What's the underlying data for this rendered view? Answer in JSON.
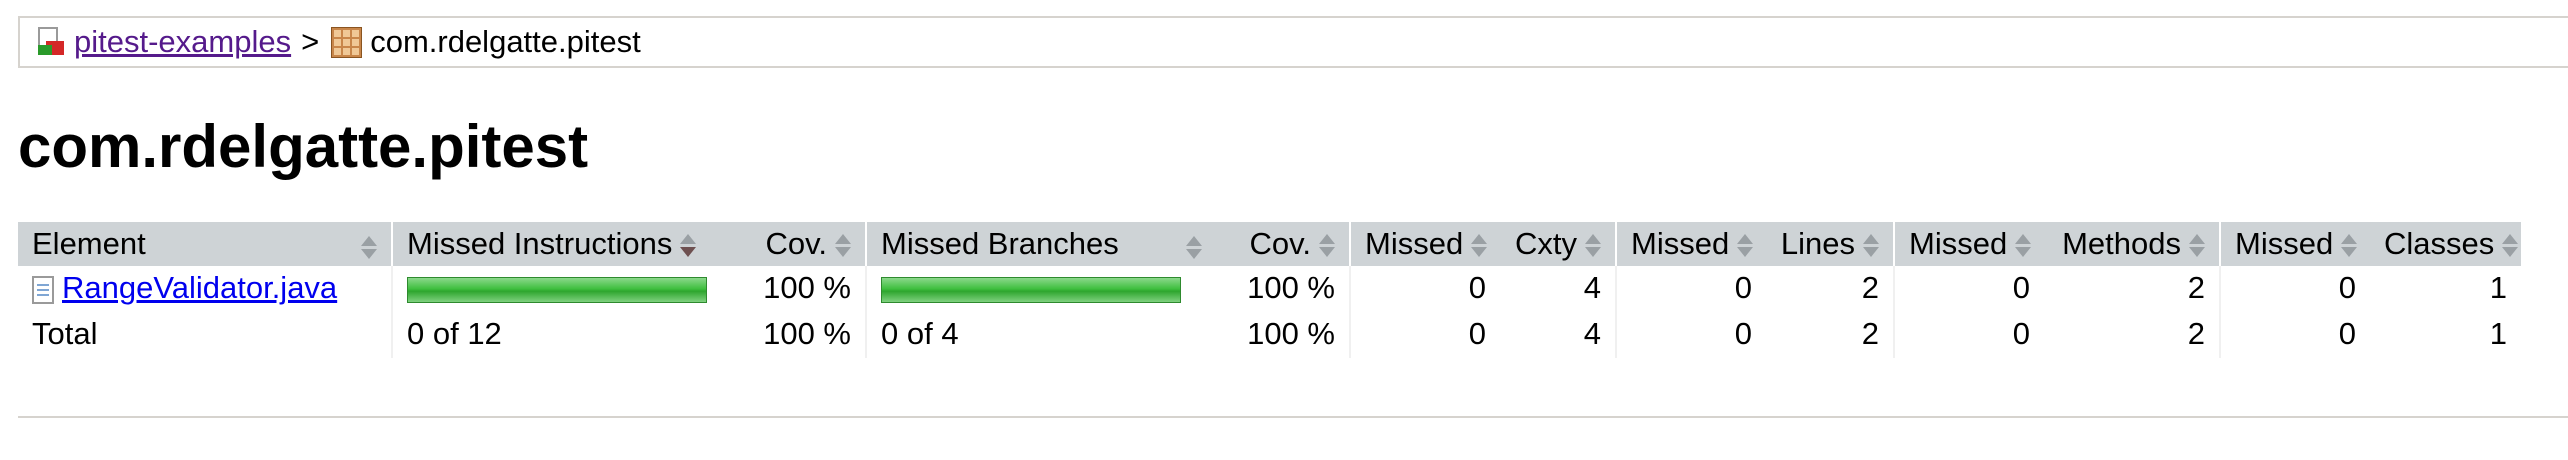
{
  "breadcrumb": {
    "root_label": "pitest-examples",
    "separator": ">",
    "package_label": "com.rdelgatte.pitest"
  },
  "page_title": "com.rdelgatte.pitest",
  "table": {
    "headers": {
      "element": "Element",
      "missed_instructions": "Missed Instructions",
      "cov1": "Cov.",
      "missed_branches": "Missed Branches",
      "cov2": "Cov.",
      "missed_cxty": "Missed",
      "cxty": "Cxty",
      "missed_lines": "Missed",
      "lines": "Lines",
      "missed_methods": "Missed",
      "methods": "Methods",
      "missed_classes": "Missed",
      "classes": "Classes"
    },
    "rows": [
      {
        "element": "RangeValidator.java",
        "instructions_coverage_fraction": 1.0,
        "cov_instructions": "100 %",
        "branches_coverage_fraction": 1.0,
        "cov_branches": "100 %",
        "missed_cxty": "0",
        "cxty": "4",
        "missed_lines": "0",
        "lines": "2",
        "missed_methods": "0",
        "methods": "2",
        "missed_classes": "0",
        "classes": "1"
      }
    ],
    "total": {
      "label": "Total",
      "missed_instructions": "0 of 12",
      "cov_instructions": "100 %",
      "missed_branches": "0 of 4",
      "cov_branches": "100 %",
      "missed_cxty": "0",
      "cxty": "4",
      "missed_lines": "0",
      "lines": "2",
      "missed_methods": "0",
      "methods": "2",
      "missed_classes": "0",
      "classes": "1"
    }
  },
  "icons": {
    "report": "report-icon",
    "package": "package-icon",
    "source_file": "source-file-icon",
    "sort": "sort-arrows-icon"
  },
  "colors": {
    "header_bg": "#ced3d6",
    "coverage_bar": "#3fbf3f",
    "link": "#0000ee",
    "visited_link": "#551a8b"
  }
}
